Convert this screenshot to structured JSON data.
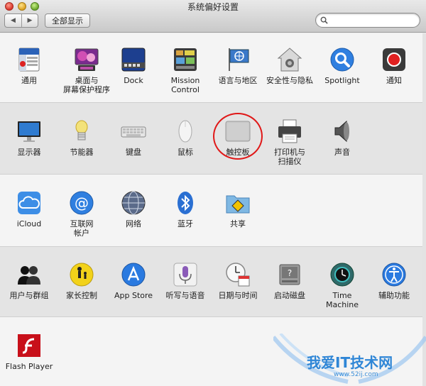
{
  "window": {
    "title": "系统偏好设置"
  },
  "toolbar": {
    "back_glyph": "◀",
    "forward_glyph": "▶",
    "show_all_label": "全部显示",
    "search_value": "",
    "search_placeholder": ""
  },
  "rows": [
    {
      "items": [
        {
          "label": "通用",
          "icon": "general-icon"
        },
        {
          "label": "桌面与\n屏幕保护程序",
          "icon": "desktop-screensaver-icon"
        },
        {
          "label": "Dock",
          "icon": "dock-icon"
        },
        {
          "label": "Mission\nControl",
          "icon": "mission-control-icon"
        },
        {
          "label": "语言与地区",
          "icon": "language-region-icon"
        },
        {
          "label": "安全性与隐私",
          "icon": "security-privacy-icon"
        },
        {
          "label": "Spotlight",
          "icon": "spotlight-icon"
        },
        {
          "label": "通知",
          "icon": "notifications-icon"
        }
      ]
    },
    {
      "items": [
        {
          "label": "显示器",
          "icon": "displays-icon"
        },
        {
          "label": "节能器",
          "icon": "energy-saver-icon"
        },
        {
          "label": "键盘",
          "icon": "keyboard-icon"
        },
        {
          "label": "鼠标",
          "icon": "mouse-icon"
        },
        {
          "label": "触控板",
          "icon": "trackpad-icon"
        },
        {
          "label": "打印机与\n扫描仪",
          "icon": "printers-scanners-icon"
        },
        {
          "label": "声音",
          "icon": "sound-icon"
        }
      ]
    },
    {
      "items": [
        {
          "label": "iCloud",
          "icon": "icloud-icon"
        },
        {
          "label": "互联网\n帐户",
          "icon": "internet-accounts-icon"
        },
        {
          "label": "网络",
          "icon": "network-icon"
        },
        {
          "label": "蓝牙",
          "icon": "bluetooth-icon"
        },
        {
          "label": "共享",
          "icon": "sharing-icon"
        }
      ]
    },
    {
      "items": [
        {
          "label": "用户与群组",
          "icon": "users-groups-icon"
        },
        {
          "label": "家长控制",
          "icon": "parental-controls-icon"
        },
        {
          "label": "App Store",
          "icon": "app-store-icon"
        },
        {
          "label": "听写与语音",
          "icon": "dictation-speech-icon"
        },
        {
          "label": "日期与时间",
          "icon": "date-time-icon"
        },
        {
          "label": "启动磁盘",
          "icon": "startup-disk-icon"
        },
        {
          "label": "Time Machine",
          "icon": "time-machine-icon"
        },
        {
          "label": "辅助功能",
          "icon": "accessibility-icon"
        }
      ]
    },
    {
      "items": [
        {
          "label": "Flash Player",
          "icon": "flash-player-icon"
        }
      ]
    }
  ],
  "icon_texts": {
    "general_file": "File",
    "general_new": "New",
    "general_open": "Ope",
    "date_day": "18",
    "flash_f": "f",
    "spotlight_glyph": "⌕"
  },
  "watermark": {
    "text": "我爱IT技术网",
    "url": "www.52ij.com"
  },
  "colors": {
    "highlight": "#e01818",
    "accent": "#2f86d6"
  }
}
